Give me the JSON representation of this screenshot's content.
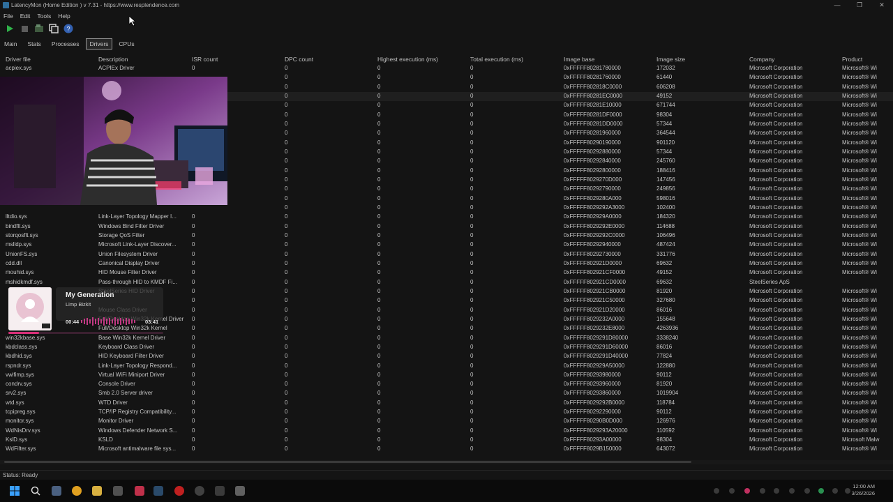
{
  "window": {
    "title": "LatencyMon  (Home Edition )  v 7.31 - https://www.resplendence.com"
  },
  "menu": [
    "File",
    "Edit",
    "Tools",
    "Help"
  ],
  "tabs": [
    {
      "label": "Main",
      "active": false
    },
    {
      "label": "Stats",
      "active": false
    },
    {
      "label": "Processes",
      "active": false
    },
    {
      "label": "Drivers",
      "active": true
    },
    {
      "label": "CPUs",
      "active": false
    }
  ],
  "columns": [
    "Driver file",
    "Description",
    "ISR count",
    "DPC count",
    "Highest execution (ms)",
    "Total execution (ms)",
    "Image base",
    "Image size",
    "Company",
    "Product"
  ],
  "rows": [
    [
      "acpiex.sys",
      "ACPIEx Driver",
      "0",
      "0",
      "0",
      "0",
      "0xFFFFF80281780000",
      "172032",
      "Microsoft Corporation",
      "Microsoft® Wi"
    ],
    [
      "",
      "",
      "",
      "0",
      "0",
      "0",
      "0xFFFFF80281760000",
      "61440",
      "Microsoft Corporation",
      "Microsoft® Wi"
    ],
    [
      "",
      "",
      "",
      "0",
      "0",
      "0",
      "0xFFFFF802818C0000",
      "606208",
      "Microsoft Corporation",
      "Microsoft® Wi"
    ],
    [
      "",
      "",
      "",
      "0",
      "0",
      "0",
      "0xFFFFF80281EC0000",
      "49152",
      "Microsoft Corporation",
      "Microsoft® Wi"
    ],
    [
      "",
      "",
      "",
      "0",
      "0",
      "0",
      "0xFFFFF80281E10000",
      "671744",
      "Microsoft Corporation",
      "Microsoft® Wi"
    ],
    [
      "",
      "",
      "",
      "0",
      "0",
      "0",
      "0xFFFFF80281DF0000",
      "98304",
      "Microsoft Corporation",
      "Microsoft® Wi"
    ],
    [
      "",
      "",
      "",
      "0",
      "0",
      "0",
      "0xFFFFF80281DD0000",
      "57344",
      "Microsoft Corporation",
      "Microsoft® Wi"
    ],
    [
      "",
      "",
      "",
      "0",
      "0",
      "0",
      "0xFFFFF80281960000",
      "364544",
      "Microsoft Corporation",
      "Microsoft® Wi"
    ],
    [
      "",
      "",
      "",
      "0",
      "0",
      "0",
      "0xFFFFF80290190000",
      "901120",
      "Microsoft Corporation",
      "Microsoft® Wi"
    ],
    [
      "",
      "",
      "",
      "0",
      "0",
      "0",
      "0xFFFFF80292880000",
      "57344",
      "Microsoft Corporation",
      "Microsoft® Wi"
    ],
    [
      "",
      "",
      "",
      "0",
      "0",
      "0",
      "0xFFFFF80292840000",
      "245760",
      "Microsoft Corporation",
      "Microsoft® Wi"
    ],
    [
      "",
      "",
      "",
      "0",
      "0",
      "0",
      "0xFFFFF80292800000",
      "188416",
      "Microsoft Corporation",
      "Microsoft® Wi"
    ],
    [
      "",
      "",
      "",
      "0",
      "0",
      "0",
      "0xFFFFF8029270D000",
      "147456",
      "Microsoft Corporation",
      "Microsoft® Wi"
    ],
    [
      "",
      "",
      "",
      "0",
      "0",
      "0",
      "0xFFFFF80292790000",
      "249856",
      "Microsoft Corporation",
      "Microsoft® Wi"
    ],
    [
      "",
      "",
      "",
      "0",
      "0",
      "0",
      "0xFFFFF8029280A000",
      "598016",
      "Microsoft Corporation",
      "Microsoft® Wi"
    ],
    [
      "",
      "",
      "",
      "0",
      "0",
      "0",
      "0xFFFFF8029292A3000",
      "102400",
      "Microsoft Corporation",
      "Microsoft® Wi"
    ],
    [
      "lltdio.sys",
      "Link-Layer Topology Mapper I...",
      "0",
      "0",
      "0",
      "0",
      "0xFFFFF802929A0000",
      "184320",
      "Microsoft Corporation",
      "Microsoft® Wi"
    ],
    [
      "bindflt.sys",
      "Windows Bind Filter Driver",
      "0",
      "0",
      "0",
      "0",
      "0xFFFFF8029292E0000",
      "114688",
      "Microsoft Corporation",
      "Microsoft® Wi"
    ],
    [
      "storqosflt.sys",
      "Storage QoS Filter",
      "0",
      "0",
      "0",
      "0",
      "0xFFFFF8029292C0000",
      "106496",
      "Microsoft Corporation",
      "Microsoft® Wi"
    ],
    [
      "mslldp.sys",
      "Microsoft Link-Layer Discover...",
      "0",
      "0",
      "0",
      "0",
      "0xFFFFF80292940000",
      "487424",
      "Microsoft Corporation",
      "Microsoft® Wi"
    ],
    [
      "UnionFS.sys",
      "Union Filesystem Driver",
      "0",
      "0",
      "0",
      "0",
      "0xFFFFF80292730000",
      "331776",
      "Microsoft Corporation",
      "Microsoft® Wi"
    ],
    [
      "cdd.dll",
      "Canonical Display Driver",
      "0",
      "0",
      "0",
      "0",
      "0xFFFFF802921D0000",
      "69632",
      "Microsoft Corporation",
      "Microsoft® Wi"
    ],
    [
      "mouhid.sys",
      "HID Mouse Filter Driver",
      "0",
      "0",
      "0",
      "0",
      "0xFFFFF802921CF0000",
      "49152",
      "Microsoft Corporation",
      "Microsoft® Wi"
    ],
    [
      "mshidkmdf.sys",
      "Pass-through HID to KMDF Fi...",
      "0",
      "0",
      "0",
      "0",
      "0xFFFFF802921CD0000",
      "69632",
      "SteelSeries ApS",
      ""
    ],
    [
      "",
      "SteelSeries HID Driver",
      "0",
      "0",
      "0",
      "0",
      "0xFFFFF802921CB0000",
      "81920",
      "Microsoft Corporation",
      "Microsoft® Wi"
    ],
    [
      "",
      "",
      "0",
      "0",
      "0",
      "0",
      "0xFFFFF802921C50000",
      "327680",
      "Microsoft Corporation",
      "Microsoft® Wi"
    ],
    [
      "",
      "Mouse Class Driver",
      "0",
      "0",
      "0",
      "0",
      "0xFFFFF802921D20000",
      "86016",
      "Microsoft Corporation",
      "Microsoft® Wi"
    ],
    [
      "",
      "Full/Desktop Win32k Kernel Driver",
      "0",
      "0",
      "0",
      "0",
      "0xFFFFF8029232A0000",
      "155648",
      "Microsoft Corporation",
      "Microsoft® Wi"
    ],
    [
      "",
      "Full/Desktop Win32k Kernel",
      "0",
      "0",
      "0",
      "0",
      "0xFFFFF8029232E8000",
      "4263936",
      "Microsoft Corporation",
      "Microsoft® Wi"
    ],
    [
      "win32kbase.sys",
      "Base Win32k Kernel Driver",
      "0",
      "0",
      "0",
      "0",
      "0xFFFFF8029291D80000",
      "3338240",
      "Microsoft Corporation",
      "Microsoft® Wi"
    ],
    [
      "kbdclass.sys",
      "Keyboard Class Driver",
      "0",
      "0",
      "0",
      "0",
      "0xFFFFF8029291D60000",
      "86016",
      "Microsoft Corporation",
      "Microsoft® Wi"
    ],
    [
      "kbdhid.sys",
      "HID Keyboard Filter Driver",
      "0",
      "0",
      "0",
      "0",
      "0xFFFFF8029291D40000",
      "77824",
      "Microsoft Corporation",
      "Microsoft® Wi"
    ],
    [
      "rspndr.sys",
      "Link-Layer Topology Respond...",
      "0",
      "0",
      "0",
      "0",
      "0xFFFFF802929A50000",
      "122880",
      "Microsoft Corporation",
      "Microsoft® Wi"
    ],
    [
      "vwifimp.sys",
      "Virtual WiFi Miniport Driver",
      "0",
      "0",
      "0",
      "0",
      "0xFFFFF80293980000",
      "90112",
      "Microsoft Corporation",
      "Microsoft® Wi"
    ],
    [
      "condrv.sys",
      "Console Driver",
      "0",
      "0",
      "0",
      "0",
      "0xFFFFF80293960000",
      "81920",
      "Microsoft Corporation",
      "Microsoft® Wi"
    ],
    [
      "srv2.sys",
      "Smb 2.0 Server driver",
      "0",
      "0",
      "0",
      "0",
      "0xFFFFF80293860000",
      "1019904",
      "Microsoft Corporation",
      "Microsoft® Wi"
    ],
    [
      "wtd.sys",
      "WTD Driver",
      "0",
      "0",
      "0",
      "0",
      "0xFFFFF8029292B0000",
      "118784",
      "Microsoft Corporation",
      "Microsoft® Wi"
    ],
    [
      "tcpipreg.sys",
      "TCP/IP Registry Compatibility...",
      "0",
      "0",
      "0",
      "0",
      "0xFFFFF80292290000",
      "90112",
      "Microsoft Corporation",
      "Microsoft® Wi"
    ],
    [
      "monitor.sys",
      "Monitor Driver",
      "0",
      "0",
      "0",
      "0",
      "0xFFFFF80290B0D000",
      "126976",
      "Microsoft Corporation",
      "Microsoft® Wi"
    ],
    [
      "WdNisDrv.sys",
      "Windows Defender Network S...",
      "0",
      "0",
      "0",
      "0",
      "0xFFFFF8029293A20000",
      "110592",
      "Microsoft Corporation",
      "Microsoft® Wi"
    ],
    [
      "KslD.sys",
      "KSLD",
      "0",
      "0",
      "0",
      "0",
      "0xFFFFF80293A00000",
      "98304",
      "Microsoft Corporation",
      "Microsoft Malw"
    ],
    [
      "WdFilter.sys",
      "Microsoft antimalware file sys...",
      "0",
      "0",
      "0",
      "0",
      "0xFFFFF8029B150000",
      "643072",
      "Microsoft Corporation",
      "Microsoft® Wi"
    ]
  ],
  "status": "Status: Ready",
  "music": {
    "song": "My Generation",
    "artist": "Limp Bizkit",
    "elapsed": "00:44",
    "duration": "03:41",
    "progress": 0.2
  },
  "clock": {
    "time": "12:00 AM",
    "date": "3/26/2026"
  },
  "colors": {
    "accent": "#d72f78",
    "background": "#141414",
    "text": "#c8c8c8"
  }
}
